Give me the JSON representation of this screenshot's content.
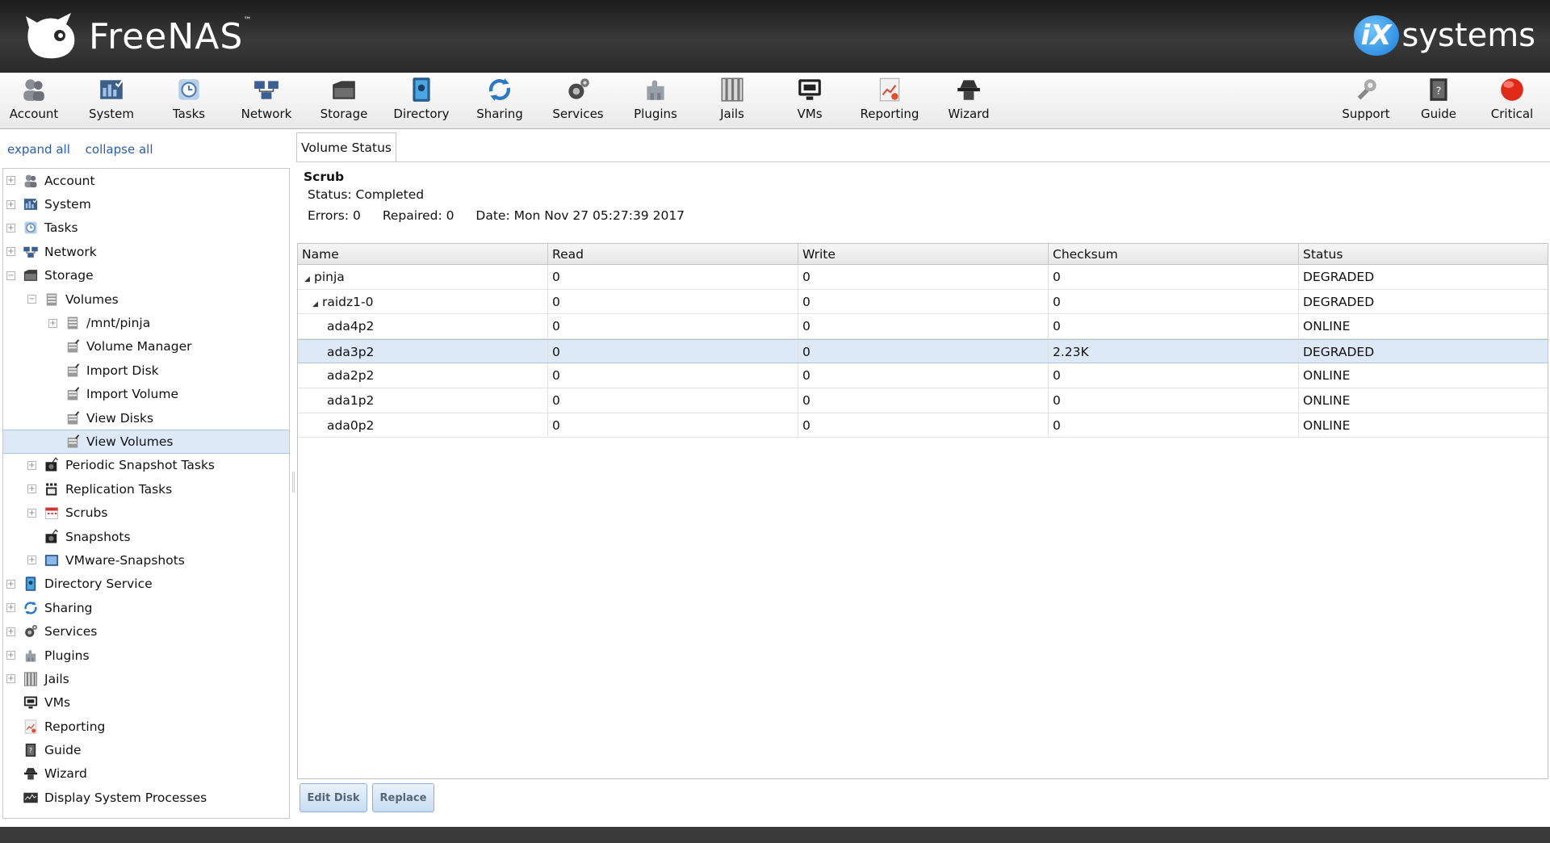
{
  "header": {
    "brand": "FreeNAS",
    "brand_mark": "™",
    "partner_badge": "iX",
    "partner_text": "systems"
  },
  "toolbar": {
    "items": [
      {
        "label": "Account",
        "icon": "account-icon"
      },
      {
        "label": "System",
        "icon": "system-icon"
      },
      {
        "label": "Tasks",
        "icon": "tasks-icon"
      },
      {
        "label": "Network",
        "icon": "network-icon"
      },
      {
        "label": "Storage",
        "icon": "storage-icon"
      },
      {
        "label": "Directory",
        "icon": "directory-icon"
      },
      {
        "label": "Sharing",
        "icon": "sharing-icon"
      },
      {
        "label": "Services",
        "icon": "services-icon"
      },
      {
        "label": "Plugins",
        "icon": "plugins-icon"
      },
      {
        "label": "Jails",
        "icon": "jails-icon"
      },
      {
        "label": "VMs",
        "icon": "vms-icon"
      },
      {
        "label": "Reporting",
        "icon": "reporting-icon"
      },
      {
        "label": "Wizard",
        "icon": "wizard-icon"
      }
    ],
    "right_items": [
      {
        "label": "Support",
        "icon": "support-icon"
      },
      {
        "label": "Guide",
        "icon": "guide-icon"
      },
      {
        "label": "Critical",
        "icon": "critical-alert-icon"
      }
    ]
  },
  "sidebar": {
    "expand_all": "expand all",
    "collapse_all": "collapse all",
    "tree": [
      {
        "label": "Account",
        "expander": "+",
        "level": 0
      },
      {
        "label": "System",
        "expander": "+",
        "level": 0
      },
      {
        "label": "Tasks",
        "expander": "+",
        "level": 0
      },
      {
        "label": "Network",
        "expander": "+",
        "level": 0
      },
      {
        "label": "Storage",
        "expander": "−",
        "level": 0
      },
      {
        "label": "Volumes",
        "expander": "−",
        "level": 1
      },
      {
        "label": "/mnt/pinja",
        "expander": "+",
        "level": 2
      },
      {
        "label": "Volume Manager",
        "expander": "",
        "level": 2
      },
      {
        "label": "Import Disk",
        "expander": "",
        "level": 2
      },
      {
        "label": "Import Volume",
        "expander": "",
        "level": 2
      },
      {
        "label": "View Disks",
        "expander": "",
        "level": 2
      },
      {
        "label": "View Volumes",
        "expander": "",
        "level": 2,
        "selected": true
      },
      {
        "label": "Periodic Snapshot Tasks",
        "expander": "+",
        "level": 1
      },
      {
        "label": "Replication Tasks",
        "expander": "+",
        "level": 1
      },
      {
        "label": "Scrubs",
        "expander": "+",
        "level": 1
      },
      {
        "label": "Snapshots",
        "expander": "",
        "level": 1
      },
      {
        "label": "VMware-Snapshots",
        "expander": "+",
        "level": 1
      },
      {
        "label": "Directory Service",
        "expander": "+",
        "level": 0
      },
      {
        "label": "Sharing",
        "expander": "+",
        "level": 0
      },
      {
        "label": "Services",
        "expander": "+",
        "level": 0
      },
      {
        "label": "Plugins",
        "expander": "+",
        "level": 0
      },
      {
        "label": "Jails",
        "expander": "+",
        "level": 0
      },
      {
        "label": "VMs",
        "expander": "",
        "level": 0
      },
      {
        "label": "Reporting",
        "expander": "",
        "level": 0
      },
      {
        "label": "Guide",
        "expander": "",
        "level": 0
      },
      {
        "label": "Wizard",
        "expander": "",
        "level": 0
      },
      {
        "label": "Display System Processes",
        "expander": "",
        "level": 0
      }
    ]
  },
  "tab": {
    "label": "Volume Status"
  },
  "scrub": {
    "title": "Scrub",
    "status": "Status: Completed",
    "errors": "Errors: 0",
    "repaired": "Repaired: 0",
    "date": "Date: Mon Nov 27 05:27:39 2017"
  },
  "grid": {
    "columns": [
      "Name",
      "Read",
      "Write",
      "Checksum",
      "Status"
    ],
    "rows": [
      {
        "name": "pinja",
        "indent": 0,
        "tri": "◢",
        "read": "0",
        "write": "0",
        "checksum": "0",
        "status": "DEGRADED"
      },
      {
        "name": "raidz1-0",
        "indent": 1,
        "tri": "◢",
        "read": "0",
        "write": "0",
        "checksum": "0",
        "status": "DEGRADED"
      },
      {
        "name": "ada4p2",
        "indent": 2,
        "tri": "",
        "read": "0",
        "write": "0",
        "checksum": "0",
        "status": "ONLINE"
      },
      {
        "name": "ada3p2",
        "indent": 2,
        "tri": "",
        "read": "0",
        "write": "0",
        "checksum": "2.23K",
        "status": "DEGRADED",
        "selected": true
      },
      {
        "name": "ada2p2",
        "indent": 2,
        "tri": "",
        "read": "0",
        "write": "0",
        "checksum": "0",
        "status": "ONLINE"
      },
      {
        "name": "ada1p2",
        "indent": 2,
        "tri": "",
        "read": "0",
        "write": "0",
        "checksum": "0",
        "status": "ONLINE"
      },
      {
        "name": "ada0p2",
        "indent": 2,
        "tri": "",
        "read": "0",
        "write": "0",
        "checksum": "0",
        "status": "ONLINE"
      }
    ]
  },
  "buttons": {
    "edit_disk": "Edit Disk",
    "replace": "Replace"
  },
  "colors": {
    "header_bg": "#2a2a2a",
    "selection": "#dde9f7",
    "link": "#2a5db0",
    "critical": "#e02a1a"
  }
}
